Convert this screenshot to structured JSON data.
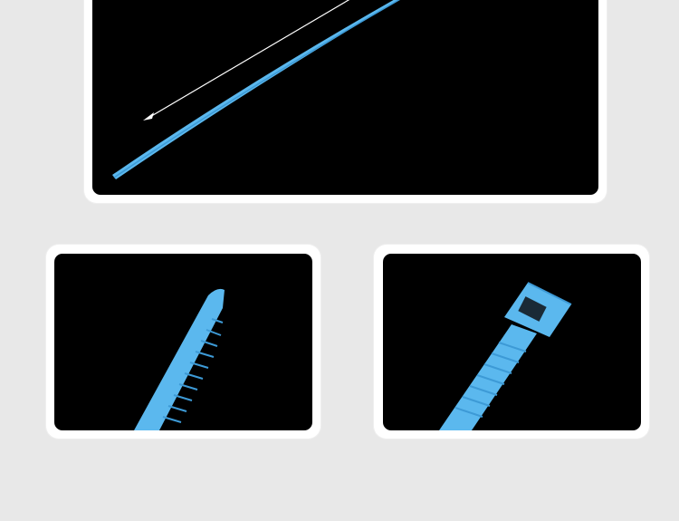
{
  "colors": {
    "background": "#e8e8e8",
    "frame": "#ffffff",
    "photo_background": "#000000",
    "cable_tie": "#5bb8ee",
    "cable_tie_shade": "#3d9ad6",
    "arrow": "#ffffff"
  },
  "photos": [
    {
      "subject": "cable-tie-full-length"
    },
    {
      "subject": "cable-tie-tip"
    },
    {
      "subject": "cable-tie-head"
    }
  ]
}
